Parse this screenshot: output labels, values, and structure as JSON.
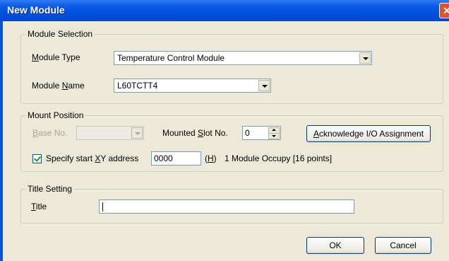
{
  "window": {
    "title": "New Module",
    "close_glyph": "✕"
  },
  "module_selection": {
    "group_label": "Module Selection",
    "type_label_pre": "",
    "type_label_key": "M",
    "type_label_post": "odule Type",
    "type_value": "Temperature Control Module",
    "name_label_pre": "Module ",
    "name_label_key": "N",
    "name_label_post": "ame",
    "name_value": "L60TCTT4"
  },
  "mount_position": {
    "group_label": "Mount Position",
    "base_label_pre": "",
    "base_label_key": "B",
    "base_label_post": "ase No.",
    "base_value": "",
    "slot_label_pre": "Mounted ",
    "slot_label_key": "S",
    "slot_label_post": "lot No.",
    "slot_value": "0",
    "ack_pre": "",
    "ack_key": "A",
    "ack_post": "cknowledge I/O Assignment",
    "specify_pre": "Specify start ",
    "specify_key": "X",
    "specify_post": "Y address",
    "specify_checked": true,
    "address_value": "0000",
    "h_pre": "(",
    "h_key": "H",
    "h_post": ")",
    "occupy_text": "1 Module Occupy [16 points]"
  },
  "title_setting": {
    "group_label": "Title Setting",
    "title_label_pre": "",
    "title_label_key": "T",
    "title_label_post": "itle",
    "title_value": ""
  },
  "buttons": {
    "ok": "OK",
    "cancel": "Cancel"
  }
}
